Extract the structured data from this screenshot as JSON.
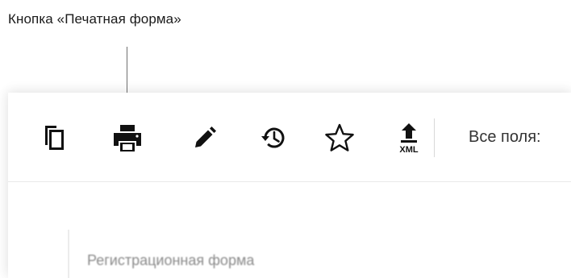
{
  "annotation": {
    "caption": "Кнопка «Печатная форма»"
  },
  "toolbar": {
    "buttons": [
      {
        "icon": "copy-icon"
      },
      {
        "icon": "printer-icon"
      },
      {
        "icon": "pencil-icon"
      },
      {
        "icon": "history-icon"
      },
      {
        "icon": "star-icon"
      },
      {
        "icon": "export-xml-icon",
        "text": "XML"
      }
    ],
    "fields_label": "Все поля:"
  },
  "form": {
    "title": "Регистрационная форма"
  }
}
